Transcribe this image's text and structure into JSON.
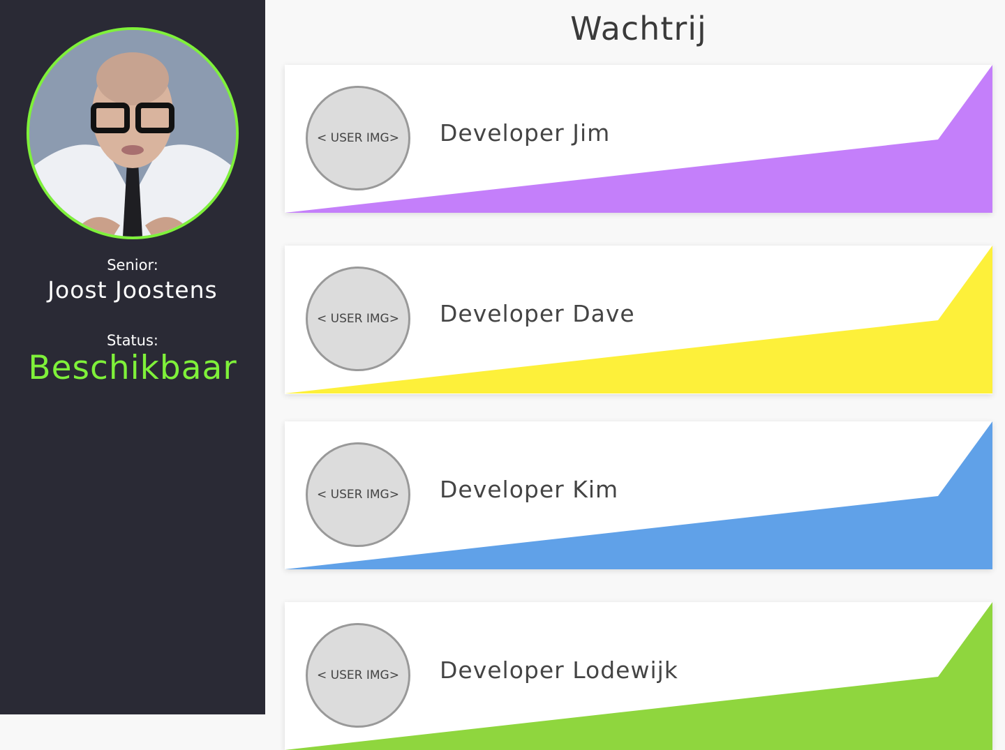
{
  "sidebar": {
    "senior_label": "Senior:",
    "senior_name": "Joost Joostens",
    "status_label": "Status:",
    "status_value": "Beschikbaar",
    "status_color": "#7ff13a"
  },
  "main": {
    "title": "Wachtrij",
    "queue": [
      {
        "avatar_placeholder": "< USER IMG>",
        "name": "Developer Jim",
        "color": "#c47ffa"
      },
      {
        "avatar_placeholder": "< USER IMG>",
        "name": "Developer Dave",
        "color": "#fdf03a"
      },
      {
        "avatar_placeholder": "< USER IMG>",
        "name": "Developer Kim",
        "color": "#60a1e8"
      },
      {
        "avatar_placeholder": "< USER IMG>",
        "name": "Developer Lodewijk",
        "color": "#8fd63e"
      }
    ]
  }
}
